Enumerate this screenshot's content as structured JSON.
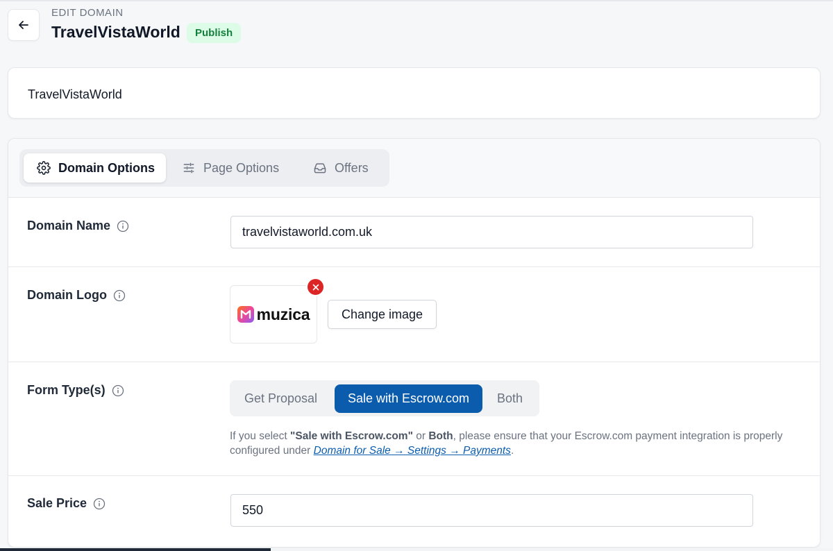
{
  "header": {
    "eyebrow": "EDIT DOMAIN",
    "title": "TravelVistaWorld",
    "status_badge": "Publish"
  },
  "name_card": {
    "value": "TravelVistaWorld"
  },
  "tabs": [
    {
      "label": "Domain Options",
      "icon": "gear-icon",
      "active": true
    },
    {
      "label": "Page Options",
      "icon": "sliders-icon",
      "active": false
    },
    {
      "label": "Offers",
      "icon": "inbox-icon",
      "active": false
    }
  ],
  "fields": {
    "domain_name": {
      "label": "Domain Name",
      "value": "travelvistaworld.com.uk"
    },
    "domain_logo": {
      "label": "Domain Logo",
      "logo_text": "muzica",
      "change_button": "Change image"
    },
    "form_type": {
      "label": "Form Type(s)",
      "options": [
        "Get Proposal",
        "Sale with Escrow.com",
        "Both"
      ],
      "selected": "Sale with Escrow.com",
      "help": {
        "prefix": "If you select ",
        "bold1": "\"Sale with Escrow.com\"",
        "mid1": " or ",
        "bold2": "Both",
        "mid2": ", please ensure that your Escrow.com payment integration is properly configured under ",
        "link": "Domain for Sale → Settings → Payments",
        "suffix": "."
      }
    },
    "sale_price": {
      "label": "Sale Price",
      "value": "550"
    }
  },
  "colors": {
    "accent": "#0b5cad",
    "badge_bg": "#dcfce7",
    "badge_text": "#15803d",
    "danger": "#dc2626"
  }
}
